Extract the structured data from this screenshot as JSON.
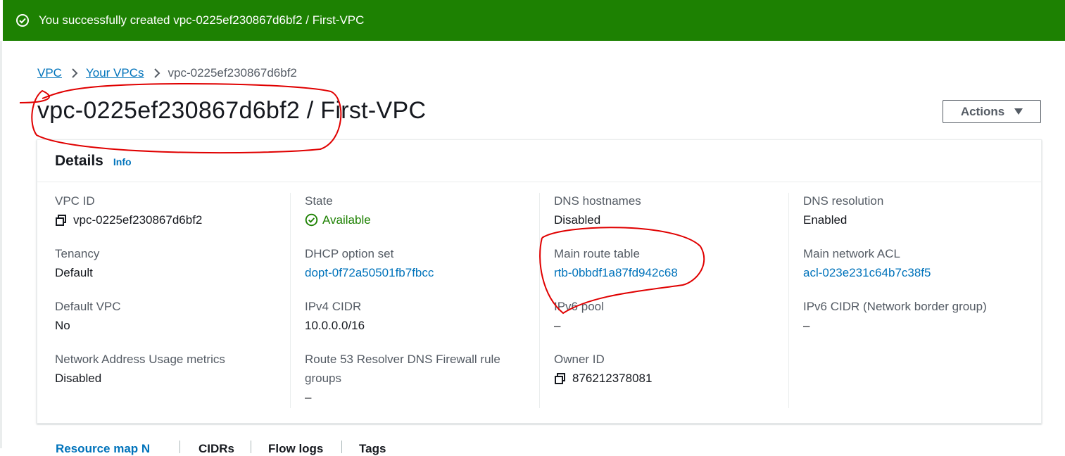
{
  "flash": {
    "message": "You successfully created vpc-0225ef230867d6bf2 / First-VPC",
    "icon": "success-check-icon"
  },
  "breadcrumb": {
    "items": [
      "VPC",
      "Your VPCs"
    ],
    "current": "vpc-0225ef230867d6bf2"
  },
  "page": {
    "title": "vpc-0225ef230867d6bf2 / First-VPC",
    "actions_label": "Actions"
  },
  "details": {
    "title": "Details",
    "info_label": "Info",
    "columns": [
      [
        {
          "label": "VPC ID",
          "value": "vpc-0225ef230867d6bf2"
        },
        {
          "label": "Tenancy",
          "value": "Default"
        },
        {
          "label": "Default VPC",
          "value": "No"
        },
        {
          "label": "Network Address Usage metrics",
          "value": "Disabled"
        }
      ],
      [
        {
          "label": "State",
          "value": "Available"
        },
        {
          "label": "DHCP option set",
          "value": "dopt-0f72a50501fb7fbcc"
        },
        {
          "label": "IPv4 CIDR",
          "value": "10.0.0.0/16"
        },
        {
          "label": "Route 53 Resolver DNS Firewall rule",
          "label2": "groups",
          "value": "–"
        }
      ],
      [
        {
          "label": "DNS hostnames",
          "value": "Disabled"
        },
        {
          "label": "Main route table",
          "value": "rtb-0bbdf1a87fd942c68"
        },
        {
          "label": "IPv6 pool",
          "value": "–"
        },
        {
          "label": "Owner ID",
          "value": "876212378081"
        }
      ],
      [
        {
          "label": "DNS resolution",
          "value": "Enabled"
        },
        {
          "label": "Main network ACL",
          "value": "acl-023e231c64b7c38f5"
        },
        {
          "label": "IPv6 CIDR (Network border group)",
          "value": "–"
        }
      ]
    ]
  },
  "tabs": [
    "Resource map N",
    "CIDRs",
    "Flow logs",
    "Tags"
  ],
  "colors": {
    "success_green": "#1d8102",
    "link_blue": "#0073bb",
    "annotation_red": "#e00000"
  }
}
